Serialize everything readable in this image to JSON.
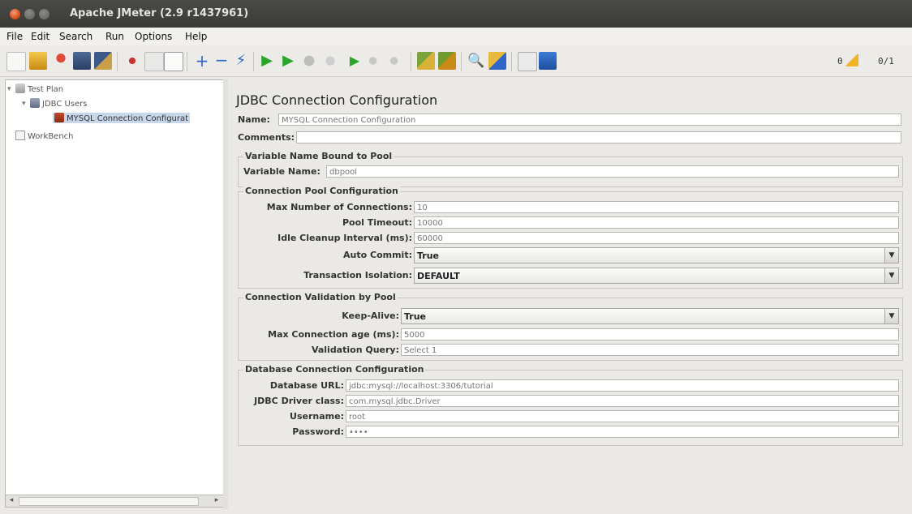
{
  "window": {
    "title": "Apache JMeter (2.9 r1437961)"
  },
  "menu": [
    "File",
    "Edit",
    "Search",
    "Run",
    "Options",
    "Help"
  ],
  "toolbar": {
    "warnings": "0",
    "threads": "0/1"
  },
  "tree": {
    "test_plan": "Test Plan",
    "jdbc_users": "JDBC Users",
    "mysql_config": "MYSQL Connection Configurat",
    "workbench": "WorkBench"
  },
  "panel": {
    "title": "JDBC Connection Configuration",
    "name_label": "Name:",
    "name_value": "MYSQL Connection Configuration",
    "comments_label": "Comments:",
    "comments_value": "",
    "var_group": {
      "title": "Variable Name Bound to Pool",
      "var_label": "Variable Name:",
      "var_value": "dbpool"
    },
    "pool_group": {
      "title": "Connection Pool Configuration",
      "max_conn_label": "Max Number of Connections:",
      "max_conn_value": "10",
      "timeout_label": "Pool Timeout:",
      "timeout_value": "10000",
      "idle_label": "Idle Cleanup Interval (ms):",
      "idle_value": "60000",
      "autocommit_label": "Auto Commit:",
      "autocommit_value": "True",
      "isolation_label": "Transaction Isolation:",
      "isolation_value": "DEFAULT"
    },
    "validation_group": {
      "title": "Connection Validation by Pool",
      "keepalive_label": "Keep-Alive:",
      "keepalive_value": "True",
      "maxage_label": "Max Connection age (ms):",
      "maxage_value": "5000",
      "query_label": "Validation Query:",
      "query_value": "Select 1"
    },
    "db_group": {
      "title": "Database Connection Configuration",
      "url_label": "Database URL:",
      "url_value": "jdbc:mysql://localhost:3306/tutorial",
      "driver_label": "JDBC Driver class:",
      "driver_value": "com.mysql.jdbc.Driver",
      "user_label": "Username:",
      "user_value": "root",
      "pass_label": "Password:",
      "pass_value": "••••"
    }
  },
  "colors": {
    "titlebar": "#3d3d3a",
    "selection": "#c8d6ea",
    "close_button": "#e0561f"
  }
}
